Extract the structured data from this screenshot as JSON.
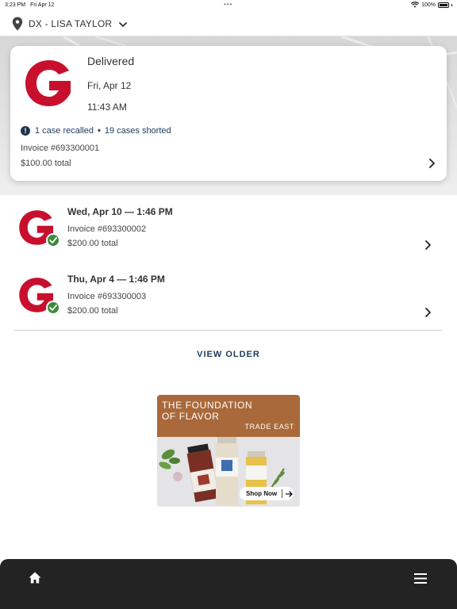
{
  "status_bar": {
    "time": "3:23 PM",
    "date": "Fri Apr 12",
    "battery": "100%"
  },
  "location": {
    "name": "DX - LISA TAYLOR",
    "icon": "location-pin-icon"
  },
  "featured_order": {
    "status": "Delivered",
    "date": "Fri, Apr 12",
    "time": "11:43 AM",
    "recalled": "1 case recalled",
    "separator": "•",
    "shorted": "19 cases shorted",
    "invoice": "Invoice #693300001",
    "total": "$100.00 total"
  },
  "orders": [
    {
      "date": "Wed, Apr 10 — 1:46 PM",
      "invoice": "Invoice #693300002",
      "total": "$200.00 total"
    },
    {
      "date": "Thu, Apr 4 — 1:46 PM",
      "invoice": "Invoice #693300003",
      "total": "$200.00 total"
    }
  ],
  "view_older_label": "VIEW OLDER",
  "ad": {
    "headline": "THE FOUNDATION OF FLAVOR",
    "brand": "TRADE EAST",
    "cta": "Shop Now"
  },
  "colors": {
    "brand_red": "#c8102e",
    "nav_bg": "#232323",
    "link_blue": "#1c3a5a",
    "success_green": "#3d8a3a",
    "ad_brown": "#a9693a"
  },
  "bottom_nav": {
    "home_icon": "home-icon",
    "menu_icon": "hamburger-menu-icon"
  }
}
